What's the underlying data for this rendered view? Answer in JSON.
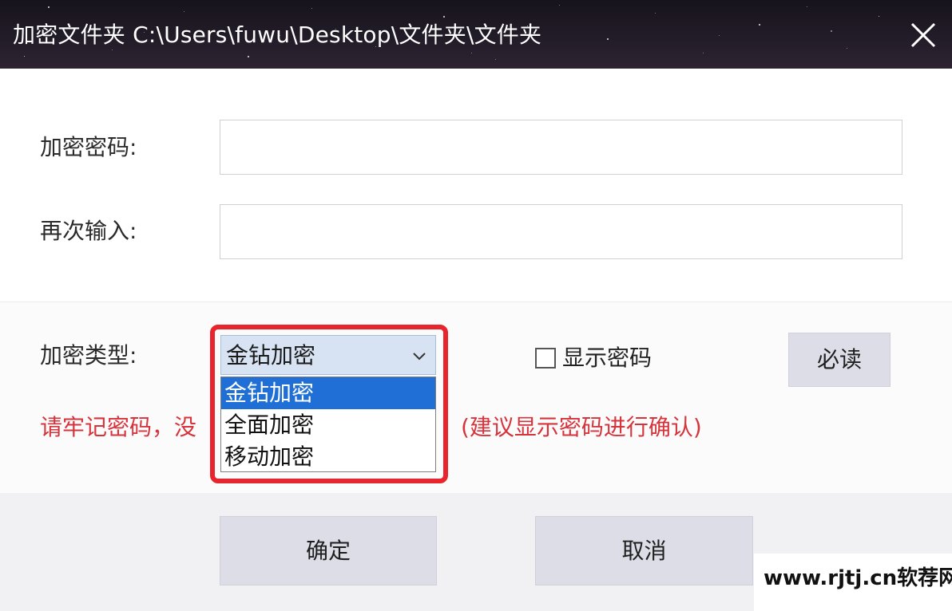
{
  "window": {
    "title": "加密文件夹  C:\\Users\\fuwu\\Desktop\\文件夹\\文件夹",
    "close_icon": "close-icon"
  },
  "form": {
    "password_label": "加密密码:",
    "password_value": "",
    "confirm_label": "再次输入:",
    "confirm_value": "",
    "type_label": "加密类型:",
    "type_selected": "金钻加密",
    "type_options": [
      "金钻加密",
      "全面加密",
      "移动加密"
    ],
    "show_password_label": "显示密码",
    "show_password_checked": false,
    "must_read_button": "必读"
  },
  "warning": {
    "left": "请牢记密码，没",
    "right": "(建议显示密码进行确认)"
  },
  "footer": {
    "ok_button": "确定",
    "cancel_button": "取消"
  },
  "watermark": {
    "text": "www.rjtj.cn软荐网"
  },
  "colors": {
    "title_bg": "#1d1822",
    "warning_text": "#d6333b",
    "highlight_frame": "#e8252c",
    "selected_option": "#1f6fd6",
    "select_box_bg": "#d7e3f3",
    "button_bg": "#dcdde6"
  }
}
